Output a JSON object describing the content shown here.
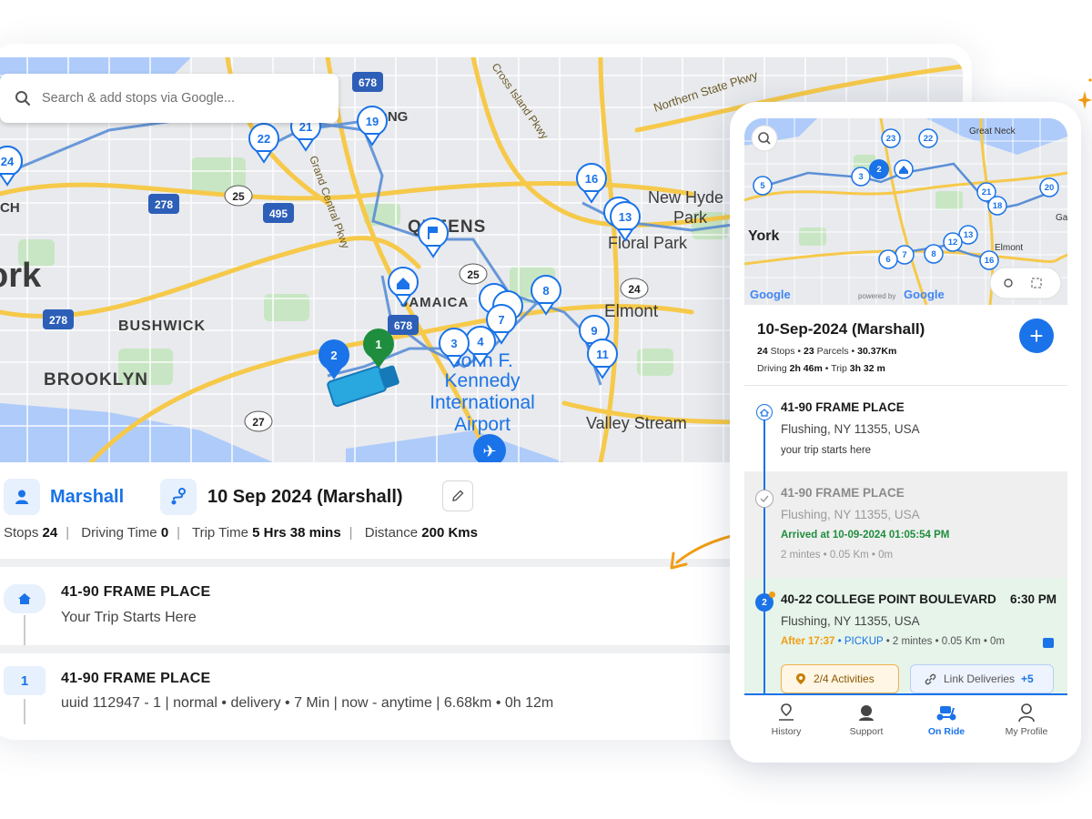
{
  "desktop": {
    "search": {
      "placeholder": "Search & add stops via Google..."
    },
    "map": {
      "labels": [
        "ork",
        "BUSHWICK",
        "BROOKLYN",
        "QUEENS",
        "JAMAICA",
        "Elmont",
        "Floral Park",
        "New Hyde",
        "Park",
        "Valley Stream",
        "John F.",
        "Kennedy",
        "International",
        "Airport",
        "Northern State Pkwy",
        "Cross Island Pkwy",
        "Grand Central Pkwy",
        "LONG",
        "CH"
      ],
      "shields": [
        "678",
        "278",
        "495",
        "25",
        "278",
        "25",
        "24",
        "27",
        "678"
      ],
      "markers": [
        "24",
        "22",
        "21",
        "19",
        "16",
        "13",
        "8",
        "7",
        "4",
        "3",
        "9",
        "11",
        "2",
        "1"
      ]
    },
    "driver_name": "Marshall",
    "trip_title": "10 Sep 2024 (Marshall)",
    "stats": {
      "stops_label": "Stops",
      "stops": "24",
      "driving_label": "Driving Time",
      "driving": "0",
      "trip_label": "Trip Time",
      "trip": "5 Hrs 38 mins",
      "distance_label": "Distance",
      "distance": "200 Kms"
    },
    "stops": [
      {
        "marker": "home",
        "title": "41-90 FRAME PLACE",
        "subtitle": "Your Trip Starts Here"
      },
      {
        "marker": "1",
        "title": "41-90 FRAME PLACE",
        "subtitle": "uuid 112947 - 1 | normal • delivery • 7 Min | now - anytime | 6.68km • 0h 12m"
      }
    ]
  },
  "phone": {
    "map": {
      "labels": [
        "York",
        "Great Neck",
        "Elmont",
        "Gar",
        "Google",
        "Google",
        "powered by"
      ],
      "markers": [
        "23",
        "22",
        "3",
        "2",
        "5",
        "21",
        "20",
        "18",
        "13",
        "12",
        "8",
        "7",
        "6",
        "16"
      ]
    },
    "trip_title": "10-Sep-2024 (Marshall)",
    "summary": {
      "stops": "24",
      "stops_label": "Stops",
      "parcels": "23",
      "parcels_label": "Parcels",
      "distance": "30.37Km",
      "driving_label": "Driving",
      "driving": "2h 46m",
      "trip_label": "Trip",
      "trip": "3h 32 m"
    },
    "stop_home": {
      "title": "41-90 FRAME PLACE",
      "address": "Flushing, NY 11355, USA",
      "note": "your trip starts here"
    },
    "stop_done": {
      "title": "41-90 FRAME PLACE",
      "address": "Flushing, NY 11355, USA",
      "arrived": "Arrived at 10-09-2024 01:05:54 PM",
      "meta": "2 mintes  • 0.05 Km • 0m"
    },
    "stop_next": {
      "marker": "2",
      "title": "40-22 COLLEGE POINT BOULEVARD",
      "time": "6:30 PM",
      "address": "Flushing, NY 11355, USA",
      "after": "After 17:37",
      "type": "• PICKUP",
      "meta": "• 2 mintes  • 0.05 Km • 0m",
      "activities": "2/4 Activities",
      "link": "Link Deliveries",
      "link_count": "+5"
    },
    "tabs": [
      "History",
      "Support",
      "On Ride",
      "My Profile"
    ]
  },
  "colors": {
    "primary": "#1a73e8",
    "green": "#1e8e3e",
    "orange": "#f29d14",
    "route": "#5b8fd6"
  }
}
